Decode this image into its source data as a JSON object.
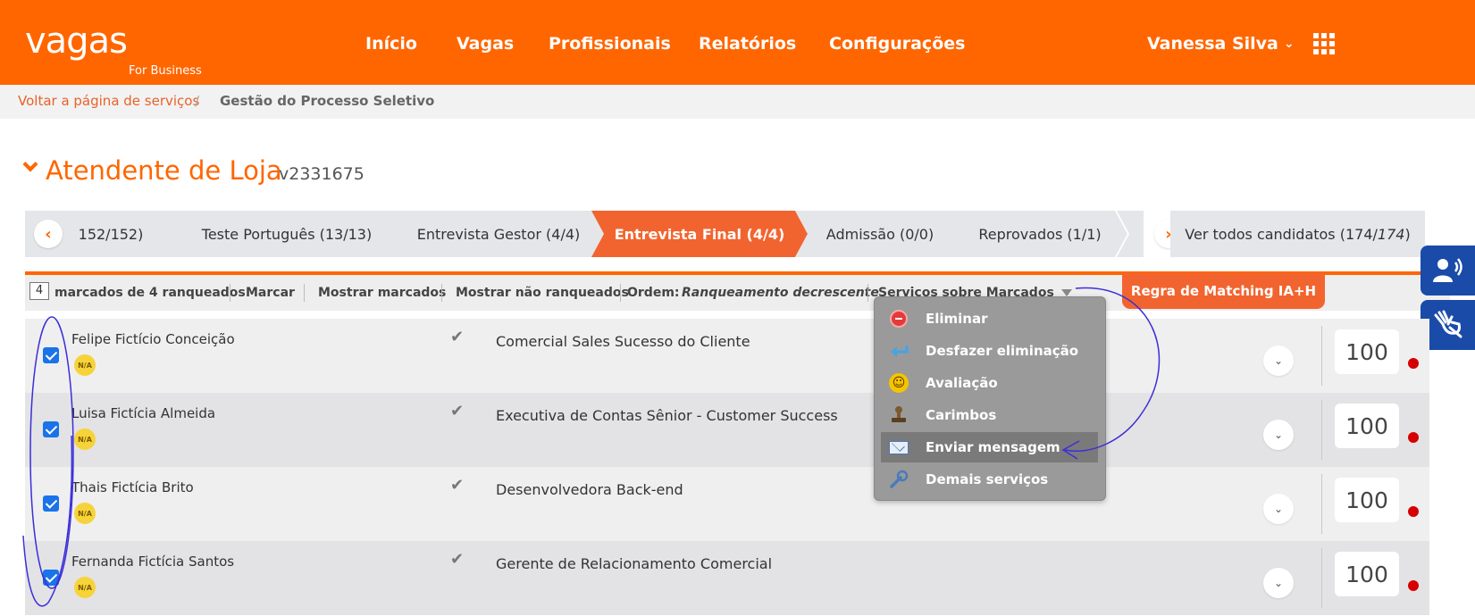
{
  "header": {
    "logo_main": "vagas",
    "logo_sub": "For Business",
    "nav": [
      "Início",
      "Vagas",
      "Profissionais",
      "Relatórios",
      "Configurações"
    ],
    "user_name": "Vanessa Silva"
  },
  "breadcrumb": {
    "back": "Voltar a página de serviços",
    "separator": "/",
    "current": "Gestão do Processo Seletivo"
  },
  "job": {
    "title": "Atendente de Loja",
    "code": "v2331675"
  },
  "stages": {
    "items": [
      "152/152)",
      "Teste Português (13/13)",
      "Entrevista Gestor (4/4)",
      "Entrevista Final (4/4)",
      "Admissão (0/0)",
      "Reprovados (1/1)"
    ],
    "active_index": 3,
    "prev_icon": "‹",
    "next_icon": "›",
    "all_prefix": "Ver todos candidatos (174/",
    "all_total": "174",
    "all_suffix": ")"
  },
  "toolbar": {
    "marked_count": "4",
    "marked_text": "marcados de 4 ranqueados",
    "mark": "Marcar",
    "show_marked": "Mostrar marcados",
    "show_unranked": "Mostrar não ranqueados",
    "order_label": "Ordem:",
    "order_value": "Ranqueamento decrescente",
    "services": "Serviços sobre Marcados",
    "matching_rule": "Regra de Matching IA+H"
  },
  "menu": {
    "items": [
      {
        "label": "Eliminar",
        "icon": "remove-icon"
      },
      {
        "label": "Desfazer eliminação",
        "icon": "undo-arrow-icon"
      },
      {
        "label": "Avaliação",
        "icon": "smiley-icon"
      },
      {
        "label": "Carimbos",
        "icon": "stamp-icon"
      },
      {
        "label": "Enviar mensagem",
        "icon": "envelope-icon"
      },
      {
        "label": "Demais serviços",
        "icon": "wrench-icon"
      }
    ],
    "highlighted_index": 4
  },
  "candidates": [
    {
      "name": "Felipe Fictício Conceição",
      "badge": "N/A",
      "role": "Comercial Sales Sucesso do Cliente",
      "score": "100",
      "checked": true
    },
    {
      "name": "Luisa Fictícia Almeida",
      "badge": "N/A",
      "role": "Executiva de Contas Sênior - Customer Success",
      "score": "100",
      "checked": true
    },
    {
      "name": "Thais Fictícia Brito",
      "badge": "N/A",
      "role": "Desenvolvedora Back-end",
      "score": "100",
      "checked": true
    },
    {
      "name": "Fernanda Fictícia Santos",
      "badge": "N/A",
      "role": "Gerente de Relacionamento Comercial",
      "score": "100",
      "checked": true
    }
  ],
  "colors": {
    "brand_orange": "#ff6600",
    "active_tab": "#f2642f",
    "accessibility_blue": "#1a4ba8",
    "annotation": "#3b2fd8"
  }
}
